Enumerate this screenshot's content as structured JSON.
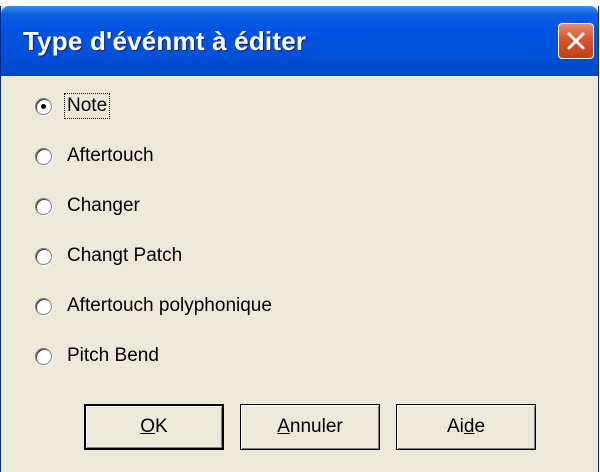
{
  "window": {
    "title": "Type d'événmt à éditer"
  },
  "options": [
    {
      "label": "Note",
      "selected": true
    },
    {
      "label": "Aftertouch",
      "selected": false
    },
    {
      "label": "Changer",
      "selected": false
    },
    {
      "label": "Changt Patch",
      "selected": false
    },
    {
      "label": "Aftertouch polyphonique",
      "selected": false
    },
    {
      "label": "Pitch Bend",
      "selected": false
    }
  ],
  "buttons": {
    "ok": {
      "pre": "",
      "accel": "O",
      "post": "K"
    },
    "cancel": {
      "pre": "",
      "accel": "A",
      "post": "nnuler"
    },
    "help": {
      "pre": "Ai",
      "accel": "d",
      "post": "e"
    }
  },
  "colors": {
    "titlebar": "#0054e3",
    "close_button": "#d9532c",
    "dialog_background": "#ece9d8"
  },
  "icons": {
    "close": "close-x-icon"
  }
}
